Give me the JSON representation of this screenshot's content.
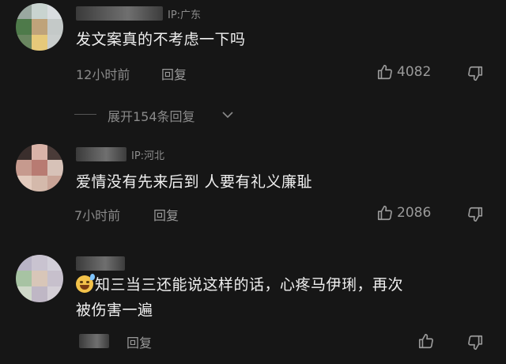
{
  "comments": [
    {
      "location": "IP:广东",
      "text": "发文案真的不考虑一下吗",
      "time": "12小时前",
      "reply_label": "回复",
      "likes": "4082"
    },
    {
      "location": "IP:河北",
      "text": "爱情没有先来后到 人要有礼义廉耻",
      "time": "7小时前",
      "reply_label": "回复",
      "likes": "2086"
    },
    {
      "text_line1": "知三当三还能说这样的话，心疼马伊琍，再次",
      "text_line2": "被伤害一遍",
      "reply_label": "回复"
    }
  ],
  "expand_label": "展开154条回复",
  "icons": {
    "like": "thumbs-up-icon",
    "dislike": "thumbs-down-icon",
    "expand": "chevron-down-icon",
    "emoji": "sweat-smile-emoji-icon"
  },
  "colors": {
    "background": "#161616",
    "text": "#ededed",
    "muted": "#8a8a8a"
  }
}
